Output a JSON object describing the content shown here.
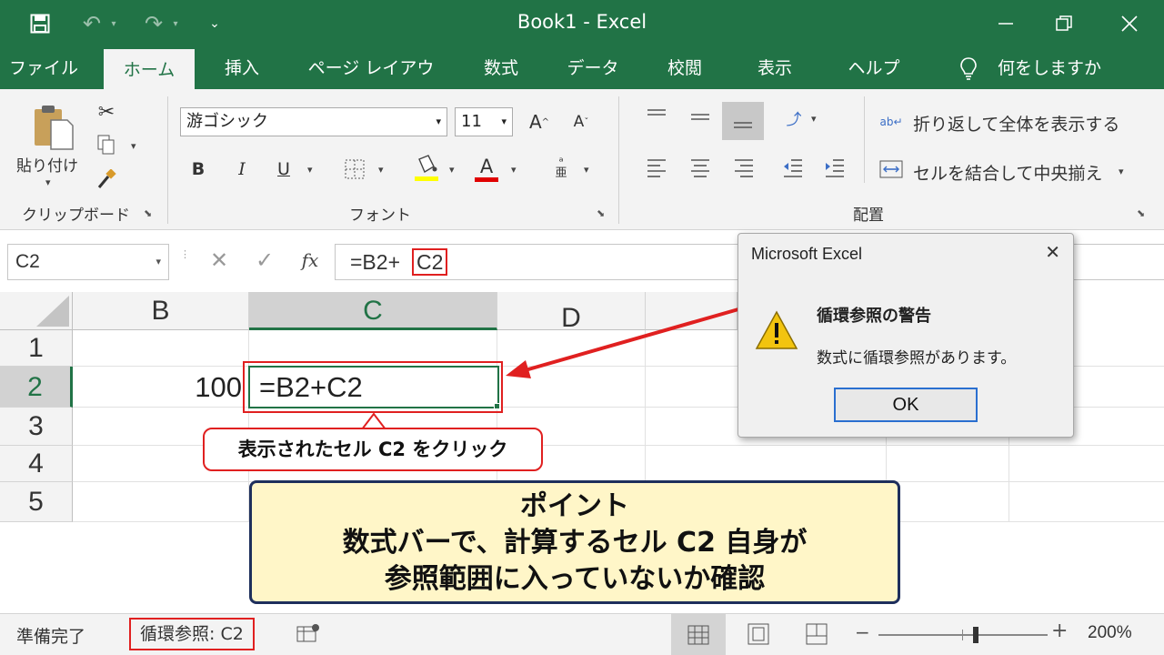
{
  "window": {
    "title": "Book1  -  Excel"
  },
  "tabs": [
    "ファイル",
    "ホーム",
    "挿入",
    "ページ レイアウト",
    "数式",
    "データ",
    "校閲",
    "表示",
    "ヘルプ"
  ],
  "tell_me": "何をしますか",
  "ribbon": {
    "paste_label": "貼り付け",
    "clipboard_label": "クリップボード",
    "font_name": "游ゴシック",
    "font_size": "11",
    "font_label": "フォント",
    "bold": "B",
    "italic": "I",
    "underline": "U",
    "grow_font": "A",
    "shrink_font": "A",
    "font_color_letter": "A",
    "wrap_text": "折り返して全体を表示する",
    "merge_center": "セルを結合して中央揃え",
    "alignment_label": "配置",
    "fx": "fx",
    "highlight_color": "#ffff00",
    "font_color": "#e00000"
  },
  "formula_bar": {
    "name_box": "C2",
    "formula_prefix": "=B2+",
    "formula_ref": "C2"
  },
  "grid": {
    "columns": [
      "B",
      "C",
      "D"
    ],
    "selected_column": "C",
    "rows": [
      "1",
      "2",
      "3",
      "4",
      "5"
    ],
    "selected_row": "2",
    "cells": {
      "B2": "100",
      "C2": "=B2+C2"
    }
  },
  "dialog": {
    "title": "Microsoft Excel",
    "heading": "循環参照の警告",
    "message": "数式に循環参照があります。",
    "ok": "OK",
    "close": "✕"
  },
  "callouts": {
    "click_hint": "表示されたセル C2 をクリック",
    "point_title": "ポイント",
    "point_line1": "数式バーで、計算するセル C2 自身が",
    "point_line2": "参照範囲に入っていないか確認"
  },
  "status": {
    "ready": "準備完了",
    "circular": "循環参照: C2",
    "zoom": "200%",
    "zoom_minus": "−",
    "zoom_plus": "+"
  },
  "colors": {
    "excel_green": "#217346",
    "annotation_red": "#e02020",
    "note_bg": "#fff6c8",
    "note_border": "#1e2f5c"
  }
}
